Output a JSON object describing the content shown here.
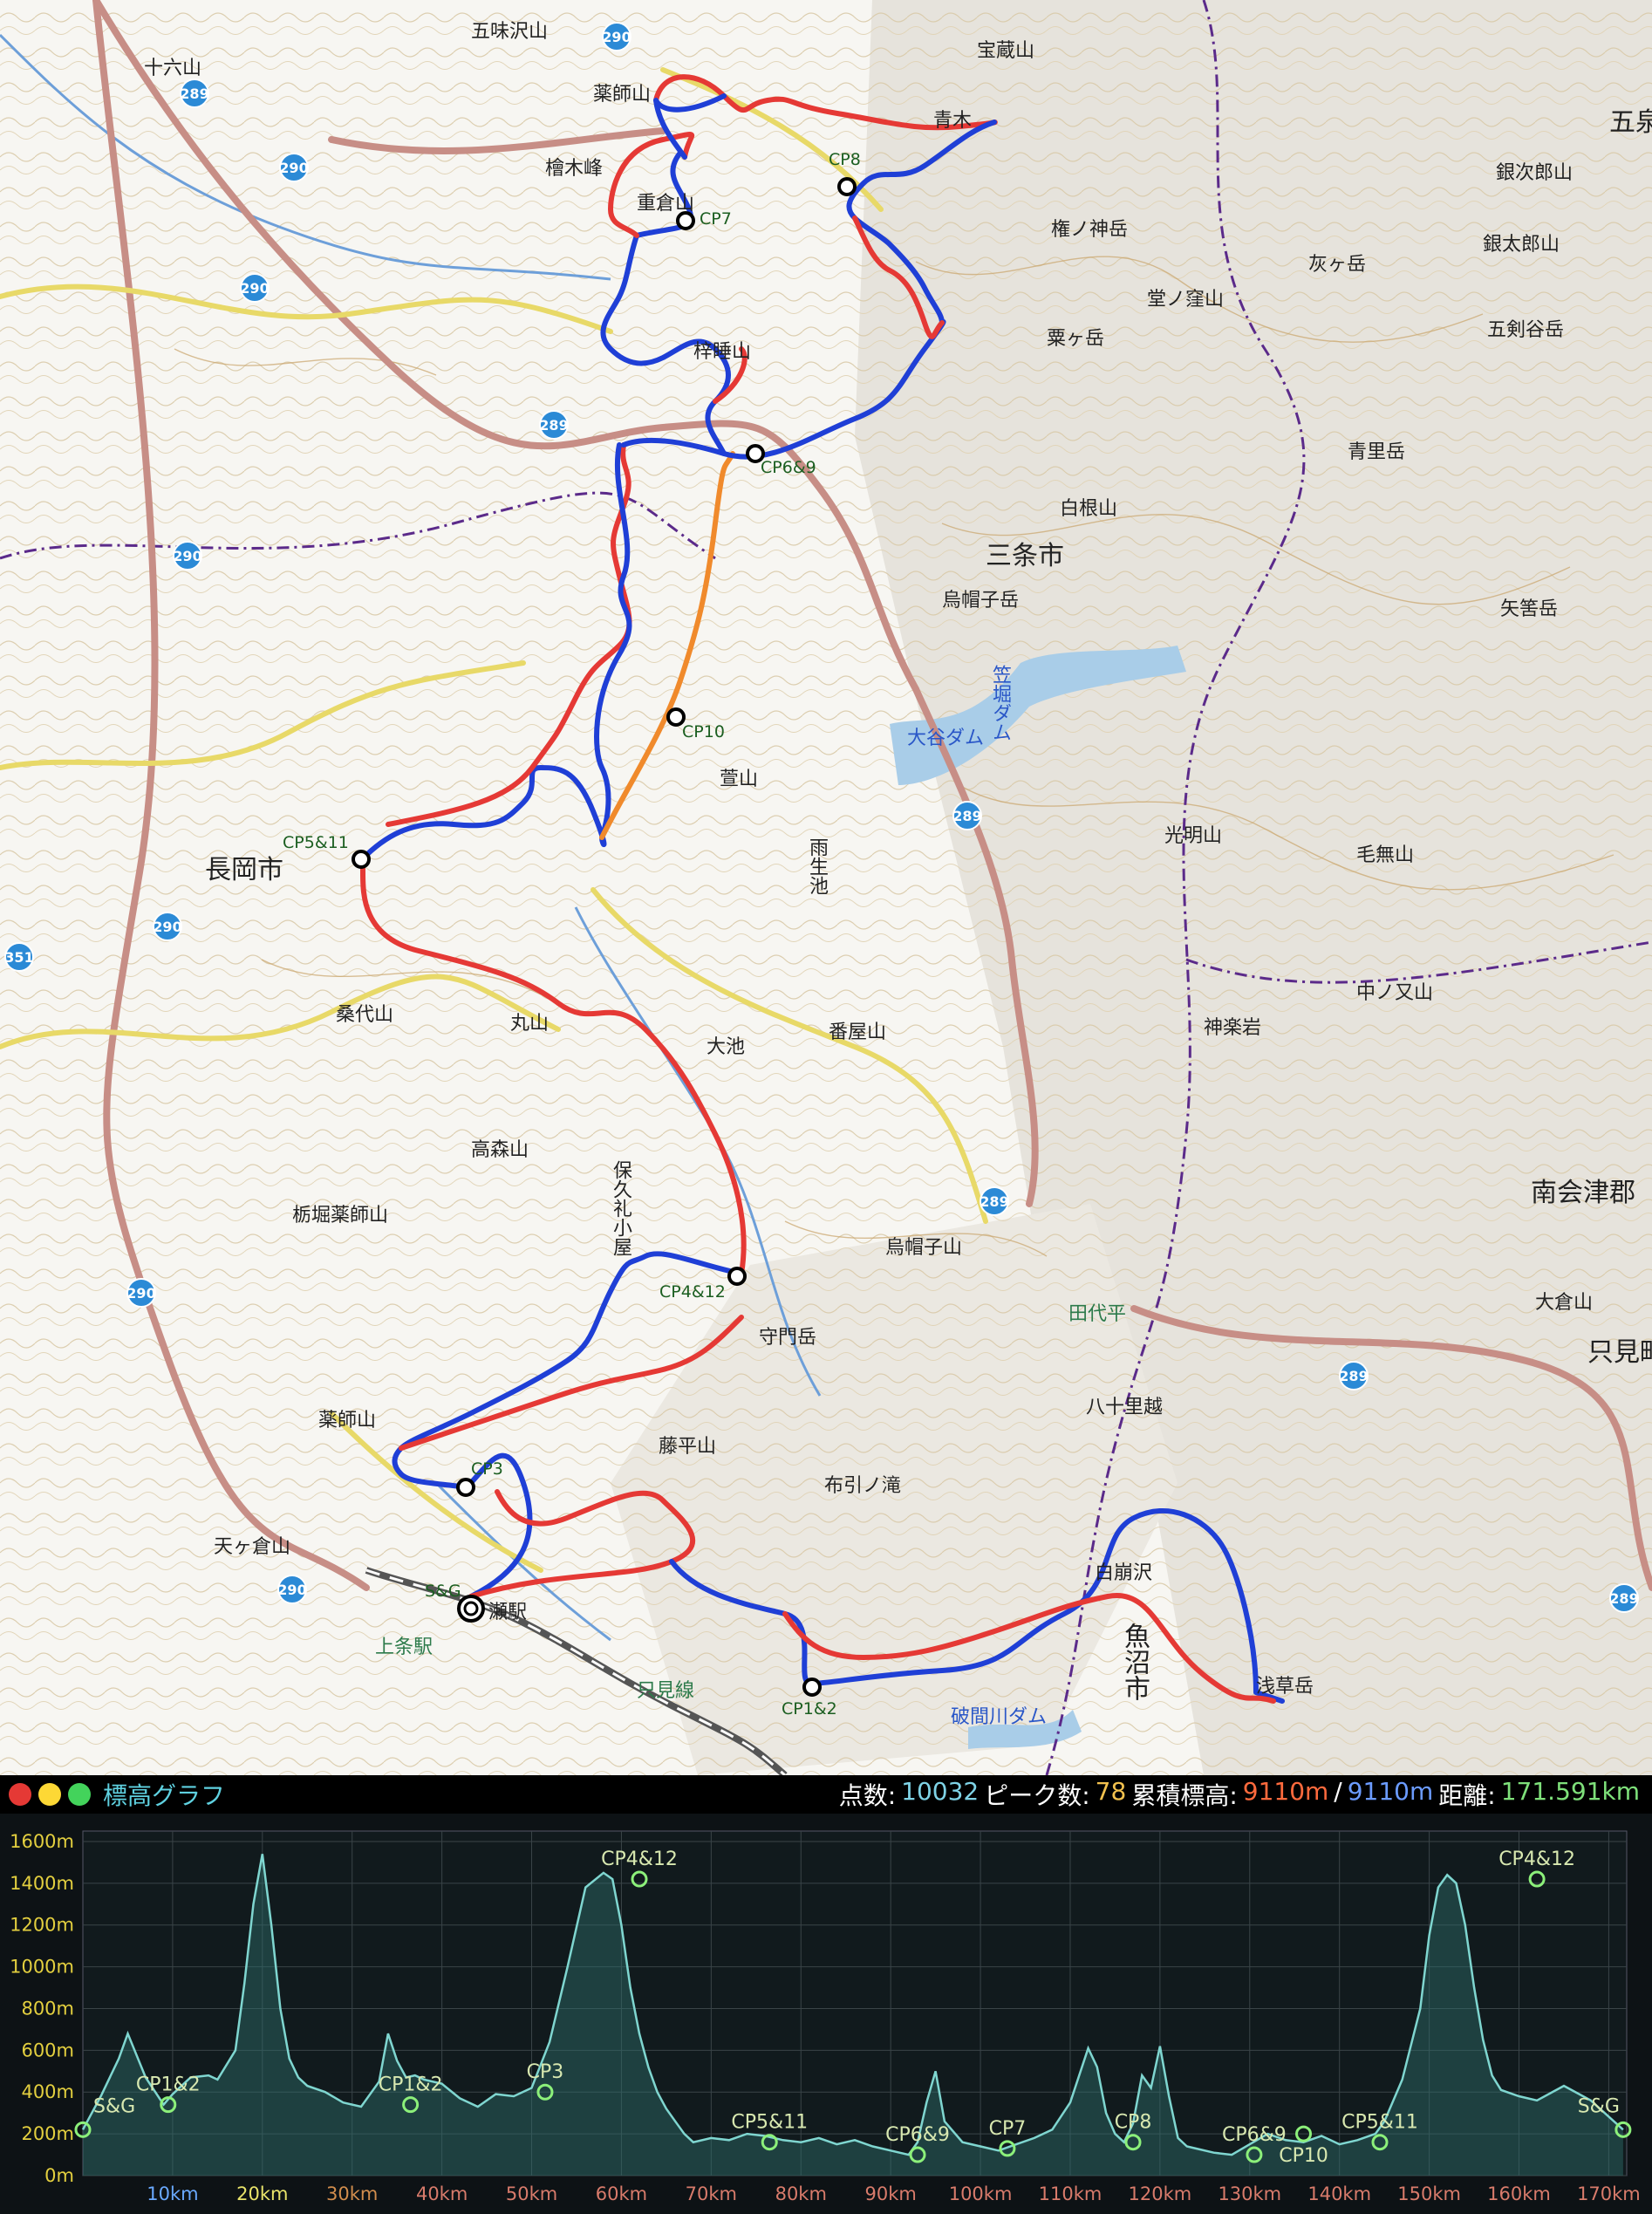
{
  "window": {
    "title": "標高グラフ"
  },
  "stats": {
    "points_label": "点数:",
    "points": "10032",
    "peaks_label": "ピーク数:",
    "peaks": "78",
    "gain_label": "累積標高:",
    "gain": "9110m",
    "sep": "/",
    "loss": "9110m",
    "distance_label": "距離:",
    "distance": "171.591km"
  },
  "colors": {
    "route_up": "#e53935",
    "route_down": "#1f3fd6",
    "profile": "#7fd6d0",
    "checkpoint": "#8cf07a"
  },
  "map": {
    "places": [
      {
        "id": "juroku",
        "text": "十六山"
      },
      {
        "id": "goshizawa",
        "text": "五味沢山"
      },
      {
        "id": "yakushi",
        "text": "薬師山"
      },
      {
        "id": "houzou",
        "text": "宝蔵山"
      },
      {
        "id": "aoki",
        "text": "青木"
      },
      {
        "id": "hinokiyama",
        "text": "檜木峰"
      },
      {
        "id": "kurosaki",
        "text": "重倉山"
      },
      {
        "id": "gongen",
        "text": "権ノ神岳"
      },
      {
        "id": "shiro",
        "text": "白根山"
      },
      {
        "id": "sanjo",
        "text": "三条市"
      },
      {
        "id": "eboshi",
        "text": "烏帽子岳"
      },
      {
        "id": "nagaoka",
        "text": "長岡市"
      },
      {
        "id": "kuwadai",
        "text": "桑代山"
      },
      {
        "id": "maru",
        "text": "丸山"
      },
      {
        "id": "takamori",
        "text": "高森山"
      },
      {
        "id": "tochiori",
        "text": "栃堀薬師山"
      },
      {
        "id": "hokure",
        "text": "保久礼小屋"
      },
      {
        "id": "eboshi2",
        "text": "烏帽子山"
      },
      {
        "id": "shumon",
        "text": "守門岳"
      },
      {
        "id": "fujihira",
        "text": "藤平山"
      },
      {
        "id": "nunobiki",
        "text": "布引ノ滝"
      },
      {
        "id": "amagakura",
        "text": "天ヶ倉山"
      },
      {
        "id": "yakushi2",
        "text": "薬師山"
      },
      {
        "id": "shirakuzure",
        "text": "白崩沢"
      },
      {
        "id": "uonuma",
        "text": "魚沼市"
      },
      {
        "id": "asakusa",
        "text": "浅草岳"
      },
      {
        "id": "minamiaizu",
        "text": "南会津郡"
      },
      {
        "id": "tadami",
        "text": "只見町"
      },
      {
        "id": "okura",
        "text": "大倉山"
      },
      {
        "id": "hachijuri",
        "text": "八十里越"
      },
      {
        "id": "tashirodaira",
        "text": "田代平"
      },
      {
        "id": "aozatodake",
        "text": "青里岳"
      },
      {
        "id": "kamigura",
        "text": "神楽岩"
      },
      {
        "id": "kaiken",
        "text": "光明山"
      },
      {
        "id": "kenmuyama",
        "text": "毛無山"
      },
      {
        "id": "nakanomata",
        "text": "中ノ又山"
      },
      {
        "id": "goken",
        "text": "五剣谷岳"
      },
      {
        "id": "ginji",
        "text": "銀次郎山"
      },
      {
        "id": "gintaro",
        "text": "銀太郎山"
      },
      {
        "id": "kurogatake",
        "text": "粟ヶ岳"
      },
      {
        "id": "dobukubo",
        "text": "堂ノ窪山"
      },
      {
        "id": "hai",
        "text": "灰ヶ岳"
      },
      {
        "id": "suigo",
        "text": "雨生池"
      },
      {
        "id": "banya",
        "text": "番屋山"
      },
      {
        "id": "oike",
        "text": "大池"
      },
      {
        "id": "kayano",
        "text": "萱山"
      },
      {
        "id": "yanaba",
        "text": "矢筈岳"
      },
      {
        "id": "goku",
        "text": "五泉"
      },
      {
        "id": "kuranomine",
        "text": "梓睡山"
      }
    ],
    "water": [
      {
        "id": "otani_dam",
        "text": "大谷ダム"
      },
      {
        "id": "kasabori",
        "text": "笠堀ダム"
      },
      {
        "id": "haguro_dam",
        "text": "破間川ダム"
      }
    ],
    "rail": [
      {
        "id": "tadami_line",
        "text": "只見線"
      },
      {
        "id": "kamijo",
        "text": "上条駅"
      },
      {
        "id": "sebashi",
        "text": "瀬駅"
      }
    ],
    "routes": [
      "289",
      "290",
      "290",
      "290",
      "289",
      "290",
      "290",
      "289",
      "351",
      "289",
      "290",
      "289",
      "289",
      "290"
    ],
    "checkpoints": [
      {
        "id": "cp8",
        "label": "CP8"
      },
      {
        "id": "cp7",
        "label": "CP7"
      },
      {
        "id": "cp69",
        "label": "CP6&9"
      },
      {
        "id": "cp10",
        "label": "CP10"
      },
      {
        "id": "cp511",
        "label": "CP5&11"
      },
      {
        "id": "cp412",
        "label": "CP4&12"
      },
      {
        "id": "cp3",
        "label": "CP3"
      },
      {
        "id": "sg",
        "label": "S&G"
      },
      {
        "id": "cp12",
        "label": "CP1&2"
      }
    ]
  },
  "chart_data": {
    "type": "area",
    "title": "",
    "xlabel": "",
    "ylabel": "",
    "xlim": [
      0,
      172
    ],
    "ylim": [
      0,
      1650
    ],
    "x_ticks": [
      "10km",
      "20km",
      "30km",
      "40km",
      "50km",
      "60km",
      "70km",
      "80km",
      "90km",
      "100km",
      "110km",
      "120km",
      "130km",
      "140km",
      "150km",
      "160km",
      "170km"
    ],
    "y_ticks": [
      "0m",
      "200m",
      "400m",
      "600m",
      "800m",
      "1000m",
      "1200m",
      "1400m",
      "1600m"
    ],
    "grid": true,
    "series": [
      {
        "x": [
          0,
          2,
          4,
          5,
          7,
          9,
          10,
          12,
          14,
          15,
          17,
          18,
          19,
          20,
          21,
          22,
          23,
          24,
          25,
          27,
          29,
          31,
          33,
          34,
          35,
          36,
          37,
          38,
          40,
          42,
          44,
          46,
          48,
          50,
          52,
          54,
          56,
          58,
          59,
          60,
          61,
          62,
          63,
          64,
          65,
          66,
          67,
          68,
          70,
          72,
          74,
          76,
          78,
          80,
          82,
          84,
          86,
          88,
          90,
          92,
          93,
          94,
          95,
          96,
          98,
          100,
          102,
          104,
          106,
          108,
          110,
          112,
          113,
          114,
          115,
          116,
          117,
          118,
          119,
          120,
          121,
          122,
          123,
          124,
          126,
          128,
          130,
          132,
          134,
          136,
          138,
          140,
          142,
          144,
          145,
          147,
          149,
          150,
          151,
          152,
          153,
          154,
          155,
          156,
          157,
          158,
          160,
          162,
          165,
          168,
          171.6
        ],
        "y": [
          220,
          380,
          560,
          680,
          470,
          340,
          390,
          470,
          480,
          460,
          600,
          920,
          1300,
          1540,
          1200,
          800,
          560,
          470,
          430,
          400,
          350,
          330,
          450,
          680,
          550,
          470,
          480,
          460,
          440,
          370,
          330,
          390,
          380,
          420,
          640,
          1000,
          1380,
          1450,
          1420,
          1200,
          900,
          680,
          520,
          400,
          320,
          260,
          200,
          160,
          180,
          170,
          200,
          190,
          170,
          160,
          180,
          150,
          170,
          140,
          120,
          100,
          160,
          350,
          500,
          260,
          160,
          140,
          120,
          150,
          180,
          220,
          350,
          610,
          520,
          300,
          200,
          160,
          250,
          480,
          420,
          620,
          380,
          180,
          140,
          130,
          110,
          100,
          150,
          200,
          170,
          160,
          190,
          150,
          170,
          200,
          260,
          460,
          800,
          1150,
          1380,
          1440,
          1400,
          1200,
          900,
          650,
          480,
          410,
          380,
          360,
          430,
          360,
          220
        ]
      }
    ],
    "markers": [
      {
        "label": "S&G",
        "x": 0,
        "y": 220
      },
      {
        "label": "CP1&2",
        "x": 9.5,
        "y": 340
      },
      {
        "label": "CP1&2",
        "x": 36.5,
        "y": 340
      },
      {
        "label": "CP3",
        "x": 51.5,
        "y": 400
      },
      {
        "label": "CP4&12",
        "x": 62,
        "y": 1420
      },
      {
        "label": "CP5&11",
        "x": 76.5,
        "y": 160
      },
      {
        "label": "CP6&9",
        "x": 93,
        "y": 100
      },
      {
        "label": "CP7",
        "x": 103,
        "y": 130
      },
      {
        "label": "CP8",
        "x": 117,
        "y": 160
      },
      {
        "label": "CP6&9",
        "x": 130.5,
        "y": 100
      },
      {
        "label": "CP10",
        "x": 136,
        "y": 200
      },
      {
        "label": "CP5&11",
        "x": 144.5,
        "y": 160
      },
      {
        "label": "CP4&12",
        "x": 162,
        "y": 1420
      },
      {
        "label": "S&G",
        "x": 171.6,
        "y": 220
      }
    ]
  }
}
